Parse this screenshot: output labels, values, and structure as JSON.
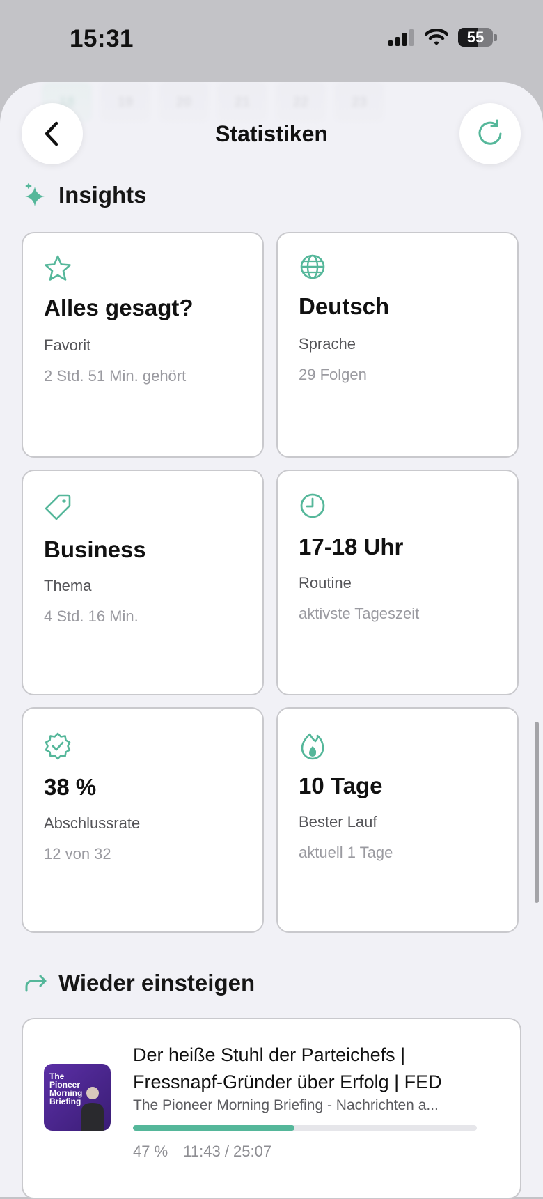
{
  "status_bar": {
    "time": "15:31",
    "battery_level": "55",
    "battery_fraction": 0.55
  },
  "header": {
    "title": "Statistiken"
  },
  "week_strip": [
    "18",
    "19",
    "20",
    "21",
    "22",
    "23"
  ],
  "insights": {
    "title": "Insights",
    "cards": [
      {
        "icon": "star-icon",
        "value": "Alles gesagt?",
        "label": "Favorit",
        "sub": "2 Std. 51 Min. gehört"
      },
      {
        "icon": "globe-icon",
        "value": "Deutsch",
        "label": "Sprache",
        "sub": "29 Folgen"
      },
      {
        "icon": "tag-icon",
        "value": "Business",
        "label": "Thema",
        "sub": "4 Std. 16 Min."
      },
      {
        "icon": "clock-icon",
        "value": "17-18 Uhr",
        "label": "Routine",
        "sub": "aktivste Tageszeit"
      },
      {
        "icon": "verified-badge-icon",
        "value": "38 %",
        "label": "Abschlussrate",
        "sub": "12 von 32"
      },
      {
        "icon": "flame-icon",
        "value": "10 Tage",
        "label": "Bester Lauf",
        "sub": "aktuell 1 Tage"
      }
    ]
  },
  "resume": {
    "title": "Wieder einsteigen",
    "item": {
      "cover_text": "The Pioneer Morning Briefing",
      "episode_title": "Der heiße Stuhl der Parteichefs | Fressnapf-Gründer über Erfolg | FED",
      "show": "The Pioneer Morning Briefing - Nachrichten a...",
      "progress_fraction": 0.47,
      "progress_label": "47 %",
      "time": "11:43 / 25:07"
    }
  },
  "colors": {
    "accent": "#55b79a",
    "background": "#f1f1f6",
    "card_border": "#c9c9cd"
  }
}
